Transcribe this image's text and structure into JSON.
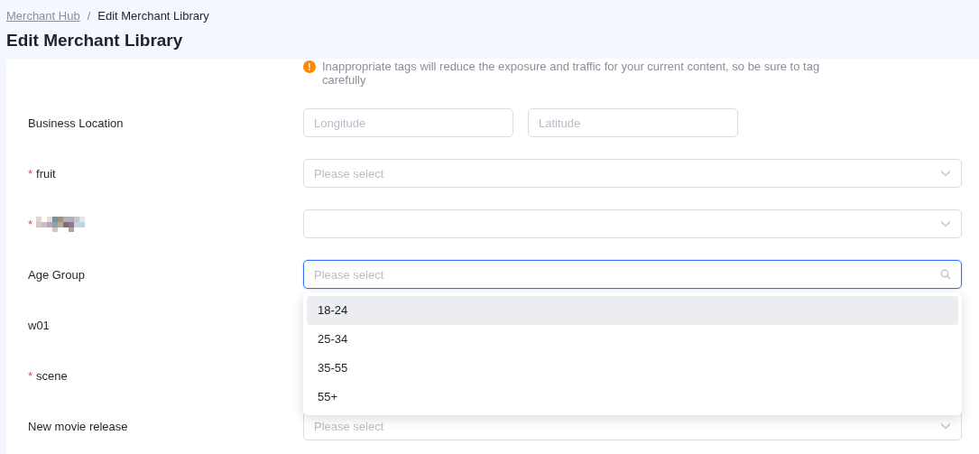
{
  "breadcrumb": [
    {
      "label": "Merchant Hub",
      "kind": "link"
    },
    {
      "label": "Edit Merchant Library",
      "kind": "current"
    }
  ],
  "breadcrumb_separator": "/",
  "title": "Edit Merchant Library",
  "required_marker": "*",
  "notice": {
    "text": "Inappropriate tags will reduce the exposure and traffic for your current content, so be sure to tag carefully",
    "icon": "!"
  },
  "fields": [
    {
      "label": "Business Location",
      "required": false,
      "kind": "coordinates",
      "inputs": [
        {
          "placeholder": "Longitude"
        },
        {
          "placeholder": "Latitude"
        }
      ]
    },
    {
      "label": "fruit",
      "required": true,
      "kind": "select",
      "placeholder": "Please select",
      "focused": false
    },
    {
      "label_redacted": true,
      "required": true,
      "kind": "select",
      "focused": false
    },
    {
      "label": "Age Group",
      "required": false,
      "kind": "select",
      "placeholder": "Please select",
      "focused": true,
      "open": true,
      "options": [
        {
          "label": "18-24",
          "selected": true
        },
        {
          "label": "25-34",
          "selected": false
        },
        {
          "label": "35-55",
          "selected": false
        },
        {
          "label": "55+",
          "selected": false
        }
      ]
    },
    {
      "label": "w01",
      "required": false,
      "kind": "hidden"
    },
    {
      "label": "scene",
      "required": true,
      "kind": "hidden"
    },
    {
      "label": "New movie release",
      "required": false,
      "kind": "select",
      "placeholder": "Please select",
      "focused": false
    }
  ]
}
